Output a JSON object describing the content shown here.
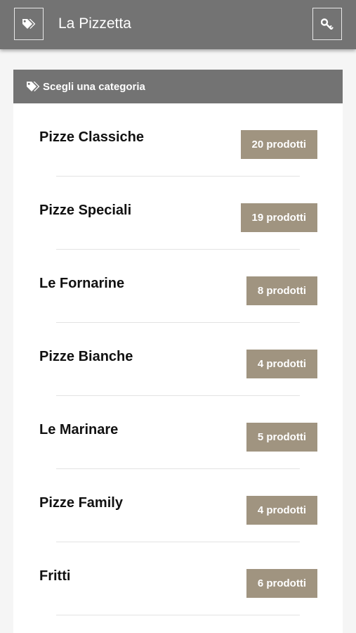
{
  "app": {
    "title": "La Pizzetta",
    "left_icon": "tags-icon",
    "right_icon": "key-icon"
  },
  "panel": {
    "header_icon": "tags-icon",
    "header_label": "Scegli una categoria"
  },
  "categories": [
    {
      "name": "Pizze Classiche",
      "count_label": "20 prodotti"
    },
    {
      "name": "Pizze Speciali",
      "count_label": "19 prodotti"
    },
    {
      "name": "Le Fornarine",
      "count_label": "8 prodotti"
    },
    {
      "name": "Pizze Bianche",
      "count_label": "4 prodotti"
    },
    {
      "name": "Le Marinare",
      "count_label": "5 prodotti"
    },
    {
      "name": "Pizze Family",
      "count_label": "4 prodotti"
    },
    {
      "name": "Fritti",
      "count_label": "6 prodotti"
    }
  ],
  "colors": {
    "bar": "#737373",
    "badge": "#a09480",
    "background": "#f5f5f5"
  }
}
